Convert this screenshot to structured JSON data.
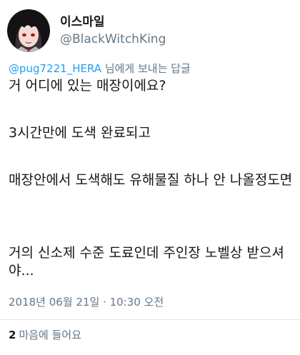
{
  "tweet": {
    "display_name": "이스마일",
    "handle": "@BlackWitchKing",
    "reply": {
      "mention": "@pug7221_HERA",
      "suffix": " 님에게 보내는 답글"
    },
    "paragraphs": [
      "거 어디에 있는 매장이에요?",
      "3시간만에 도색 완료되고",
      "매장안에서 도색해도 유해물질 하나 안 나올정도면",
      "거의 신소제 수준 도료인데 주인장 노벨상 받으셔야..."
    ],
    "timestamp": "2018년 06월 21일 · 10:30 오전",
    "likes": {
      "count": "2",
      "label": "마음에 들어요"
    }
  },
  "colors": {
    "text": "#14171a",
    "secondary": "#657786",
    "link": "#1da1f2",
    "divider": "#e1e8ed"
  },
  "icons": {
    "avatar": "anime-character-avatar"
  }
}
